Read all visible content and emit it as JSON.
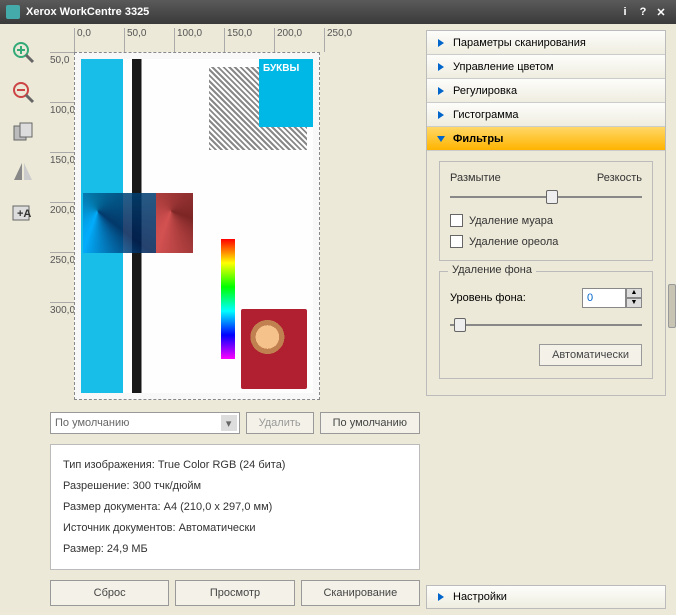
{
  "title": "Xerox WorkCentre 3325",
  "rulerH": [
    "0,0",
    "50,0",
    "100,0",
    "150,0",
    "200,0",
    "250,0"
  ],
  "rulerV": [
    "50,0",
    "100,0",
    "150,0",
    "200,0",
    "250,0",
    "300,0"
  ],
  "cyanbox": "БУКВЫ",
  "preset": {
    "combo": "По умолчанию",
    "delete": "Удалить",
    "default": "По умолчанию"
  },
  "info": {
    "l1": "Тип изображения: True Color RGB (24 бита)",
    "l2": "Разрешение: 300 тчк/дюйм",
    "l3": "Размер документа: A4 (210,0 x 297,0 мм)",
    "l4": "Источник документов: Автоматически",
    "l5": "Размер: 24,9 МБ"
  },
  "buttons": {
    "reset": "Сброс",
    "preview": "Просмотр",
    "scan": "Сканирование"
  },
  "sections": {
    "scanparams": "Параметры сканирования",
    "color": "Управление цветом",
    "adjust": "Регулировка",
    "histogram": "Гистограмма",
    "filters": "Фильтры",
    "settings": "Настройки"
  },
  "filters": {
    "blur": "Размытие",
    "sharpen": "Резкость",
    "descreen": "Удаление муара",
    "dehalo": "Удаление ореола",
    "bgremove": "Удаление фона",
    "bglevel": "Уровень фона:",
    "bgvalue": "0",
    "auto": "Автоматически"
  }
}
